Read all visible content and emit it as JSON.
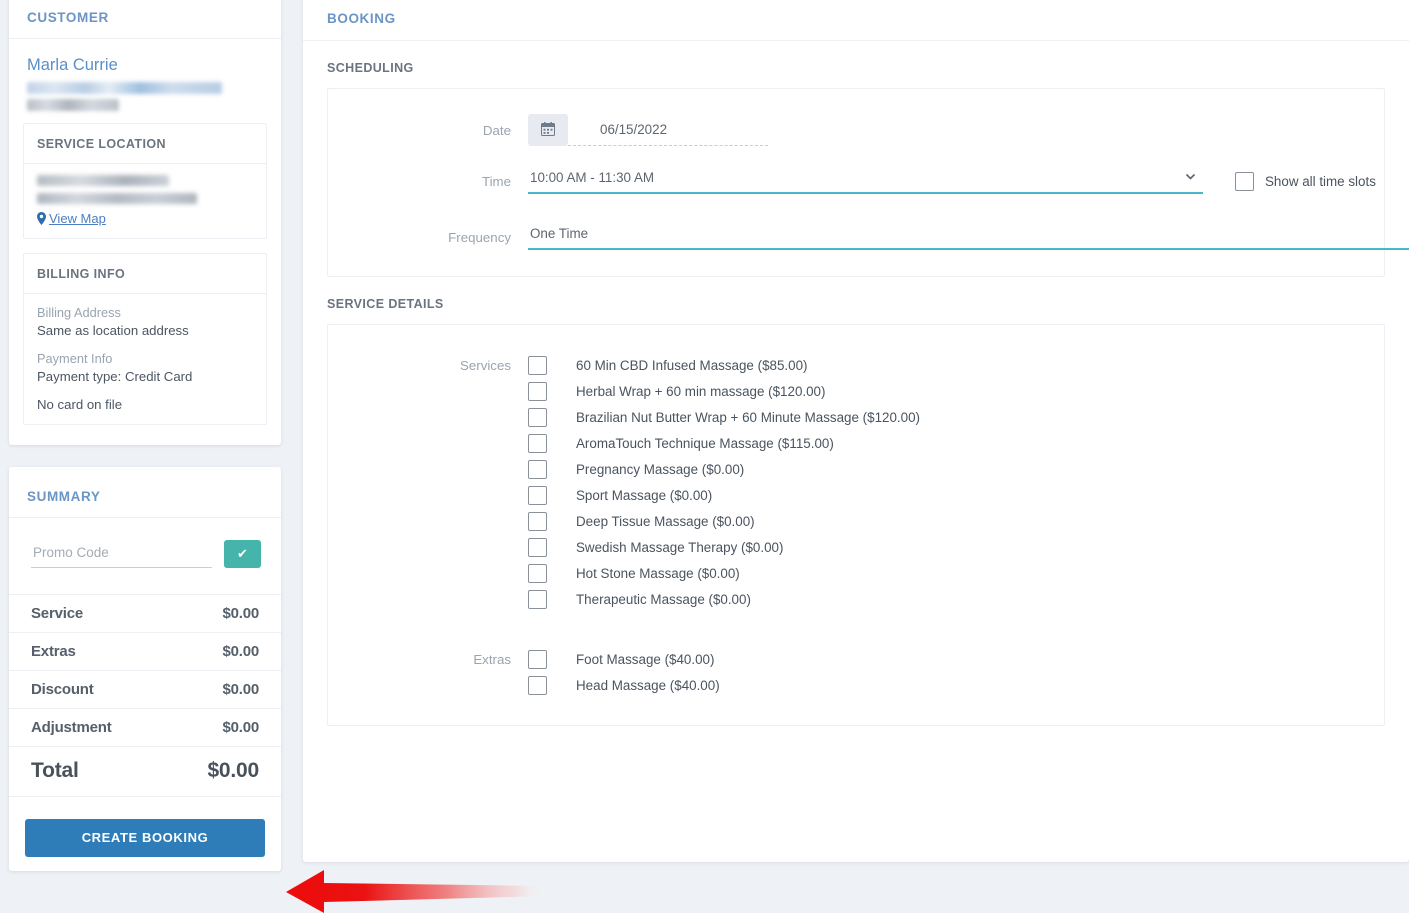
{
  "customer": {
    "title": "CUSTOMER",
    "name": "Marla Currie",
    "service_location": {
      "title": "SERVICE LOCATION",
      "view_map_label": "View Map"
    },
    "billing": {
      "title": "BILLING INFO",
      "billing_address_label": "Billing Address",
      "billing_address_value": "Same as location address",
      "payment_info_label": "Payment Info",
      "payment_type_value": "Payment type: Credit Card",
      "card_status": "No card on file"
    }
  },
  "summary": {
    "title": "SUMMARY",
    "promo_placeholder": "Promo Code",
    "promo_value": "",
    "apply_icon": "check-icon",
    "rows": [
      {
        "label": "Service",
        "value": "$0.00"
      },
      {
        "label": "Extras",
        "value": "$0.00"
      },
      {
        "label": "Discount",
        "value": "$0.00"
      },
      {
        "label": "Adjustment",
        "value": "$0.00"
      }
    ],
    "total": {
      "label": "Total",
      "value": "$0.00"
    },
    "cta_label": "CREATE BOOKING"
  },
  "booking": {
    "title": "BOOKING",
    "scheduling": {
      "heading": "SCHEDULING",
      "date_label": "Date",
      "date_value": "06/15/2022",
      "calendar_icon": "calendar-icon",
      "time_label": "Time",
      "time_value": "10:00 AM - 11:30 AM",
      "show_all_label": "Show all time slots",
      "show_all_checked": false,
      "frequency_label": "Frequency",
      "frequency_value": "One Time"
    },
    "service_details": {
      "heading": "SERVICE DETAILS",
      "services_label": "Services",
      "services": [
        {
          "label": "60 Min CBD Infused Massage ($85.00)",
          "checked": false
        },
        {
          "label": "Herbal Wrap + 60 min massage ($120.00)",
          "checked": false
        },
        {
          "label": "Brazilian Nut Butter Wrap + 60 Minute Massage ($120.00)",
          "checked": false
        },
        {
          "label": "AromaTouch Technique Massage ($115.00)",
          "checked": false
        },
        {
          "label": "Pregnancy Massage ($0.00)",
          "checked": false
        },
        {
          "label": "Sport Massage ($0.00)",
          "checked": false
        },
        {
          "label": "Deep Tissue Massage ($0.00)",
          "checked": false
        },
        {
          "label": "Swedish Massage Therapy ($0.00)",
          "checked": false
        },
        {
          "label": "Hot Stone Massage ($0.00)",
          "checked": false
        },
        {
          "label": "Therapeutic Massage ($0.00)",
          "checked": false
        }
      ],
      "extras_label": "Extras",
      "extras": [
        {
          "label": "Foot Massage ($40.00)",
          "checked": false
        },
        {
          "label": "Head Massage ($40.00)",
          "checked": false
        }
      ]
    }
  },
  "annotation": {
    "arrow_icon": "red-arrow-left",
    "arrow_color": "#ee1111",
    "points_at": "create-booking-button"
  },
  "colors": {
    "accent_blue": "#6b95c4",
    "link_blue": "#4b7fc0",
    "teal": "#45b5ab",
    "underline_teal": "#45b9c9",
    "primary_button": "#2e7cb8",
    "page_bg": "#eef1f5"
  }
}
